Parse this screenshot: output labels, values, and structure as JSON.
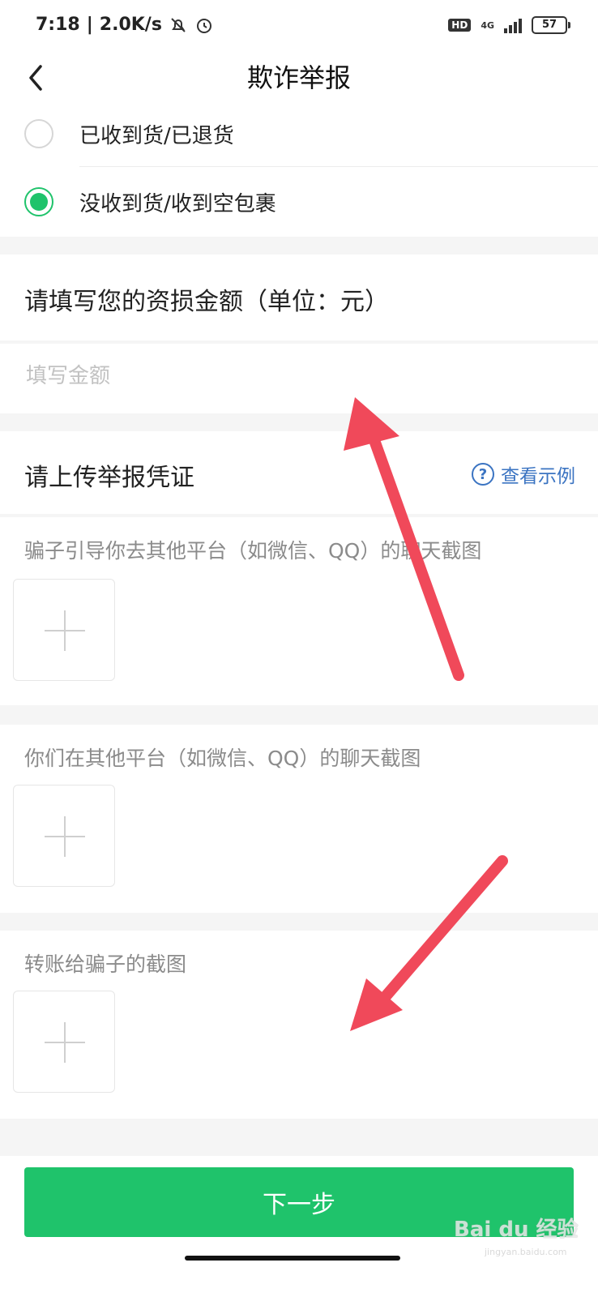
{
  "status_bar": {
    "time": "7:18",
    "speed": "2.0K/s",
    "hd": "HD",
    "network": "4G",
    "battery": "57"
  },
  "nav": {
    "title": "欺诈举报"
  },
  "receipt_options": [
    {
      "label": "已收到货/已退货",
      "checked": false
    },
    {
      "label": "没收到货/收到空包裹",
      "checked": true
    }
  ],
  "amount": {
    "title": "请填写您的资损金额（单位：元）",
    "placeholder": "填写金额",
    "value": ""
  },
  "evidence": {
    "title": "请上传举报凭证",
    "example_link": "查看示例",
    "uploads": [
      {
        "caption": "骗子引导你去其他平台（如微信、QQ）的聊天截图"
      },
      {
        "caption": "你们在其他平台（如微信、QQ）的聊天截图"
      },
      {
        "caption": "转账给骗子的截图"
      }
    ]
  },
  "footer": {
    "next_label": "下一步"
  },
  "watermark": {
    "text": "Bai du 经验",
    "sub": "jingyan.baidu.com"
  },
  "colors": {
    "accent": "#1fc36b",
    "link": "#3b74c2",
    "annotation_arrow": "#f0495a"
  },
  "icons": {
    "back": "chevron-left",
    "help": "question-circle",
    "add": "plus"
  }
}
